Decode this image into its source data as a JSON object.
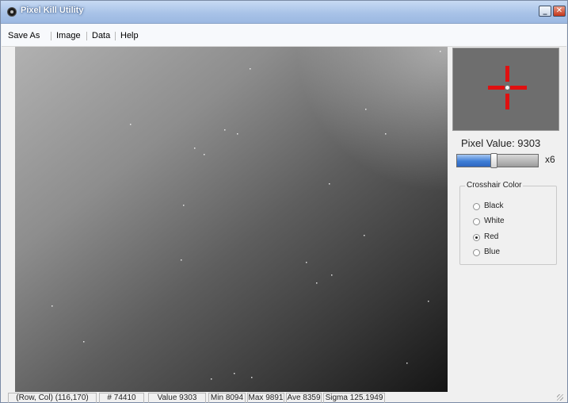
{
  "window": {
    "title": "Pixel Kill Utility",
    "minimize_label": "_",
    "close_label": "✕",
    "icon": "app-icon"
  },
  "menu": [
    "Save As",
    "Image",
    "Data",
    "Help"
  ],
  "zoom_view": {
    "crosshair_color": "#e01010"
  },
  "pixel_value": "Pixel Value: 9303",
  "zoom": {
    "label": "x6",
    "slider_level": 0.45
  },
  "crosshair": {
    "title": "Crosshair Color",
    "options": [
      "Black",
      "White",
      "Red",
      "Blue"
    ],
    "selected": "Red"
  },
  "status": {
    "rowcol": "(Row, Col) (116,170)",
    "index": "# 74410",
    "value": "Value 9303",
    "min": "Min 8094",
    "max": "Max 9891",
    "ave": "Ave 8359",
    "sigma": "Sigma 125.1949"
  }
}
